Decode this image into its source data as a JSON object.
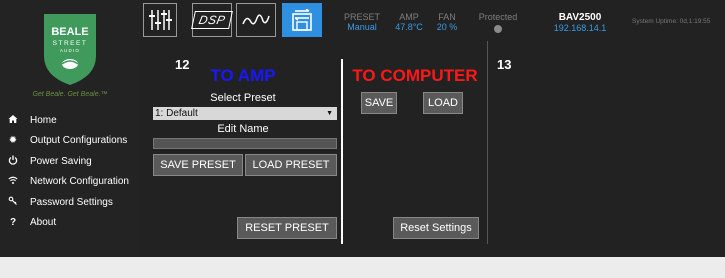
{
  "brand": {
    "logo_lines": [
      "BEALE",
      "STREET",
      "AUDIO"
    ],
    "tagline": "Get Beale. Get Beale.™",
    "logo_color": "#3f9a5c"
  },
  "sidebar": {
    "items": [
      {
        "label": "Home",
        "icon": "home-icon"
      },
      {
        "label": "Output Configurations",
        "icon": "gear-icon"
      },
      {
        "label": "Power Saving",
        "icon": "power-icon"
      },
      {
        "label": "Network Configuration",
        "icon": "wifi-icon"
      },
      {
        "label": "Password Settings",
        "icon": "key-icon"
      },
      {
        "label": "About",
        "icon": "question-icon"
      }
    ]
  },
  "toolbar": {
    "tabs": [
      {
        "name": "eq-sliders",
        "icon": "sliders-icon"
      },
      {
        "name": "dsp",
        "label": "DSP"
      },
      {
        "name": "waveform",
        "icon": "waveform-icon"
      },
      {
        "name": "save-load",
        "icon": "save-icon",
        "active": true
      }
    ],
    "preset": {
      "label": "PRESET",
      "value": "Manual"
    },
    "amp": {
      "label": "AMP",
      "value": "47.8°C"
    },
    "fan": {
      "label": "FAN",
      "value": "20 %"
    },
    "protected": {
      "label": "Protected"
    },
    "device": {
      "name": "BAV2500",
      "ip": "192.168.14.1"
    },
    "uptime": "System Uptime: 0d,1:19:55"
  },
  "panel": {
    "num_left": "12",
    "num_right": "13",
    "to_amp": "TO AMP",
    "to_computer": "TO COMPUTER",
    "select_preset_label": "Select Preset",
    "select_preset_value": "1: Default",
    "edit_name_label": "Edit Name",
    "save_preset": "SAVE PRESET",
    "load_preset": "LOAD PRESET",
    "save": "SAVE",
    "load": "LOAD",
    "reset_preset": "RESET PRESET",
    "reset_settings": "Reset Settings"
  },
  "colors": {
    "accent": "#2f8fe0",
    "value_blue": "#3a9be6",
    "amp_heading": "#1818ff",
    "computer_heading": "#ff1818"
  }
}
